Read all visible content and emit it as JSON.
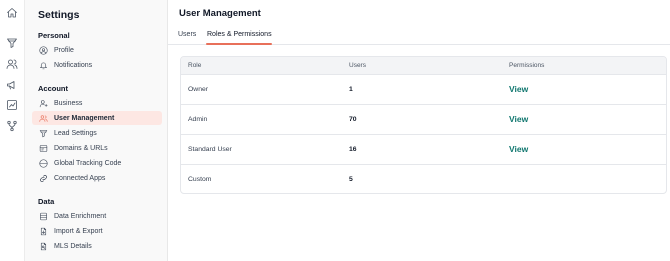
{
  "rail": {
    "icons": [
      "home-icon",
      "funnel-icon",
      "users-icon",
      "megaphone-icon",
      "chart-icon",
      "workflow-icon"
    ]
  },
  "sidebar": {
    "title": "Settings",
    "sections": [
      {
        "title": "Personal",
        "items": [
          {
            "label": "Profile",
            "icon": "user-circle-icon"
          },
          {
            "label": "Notifications",
            "icon": "bell-icon"
          }
        ]
      },
      {
        "title": "Account",
        "items": [
          {
            "label": "Business",
            "icon": "business-user-icon"
          },
          {
            "label": "User Management",
            "icon": "users-icon",
            "active": true
          },
          {
            "label": "Lead Settings",
            "icon": "funnel-icon"
          },
          {
            "label": "Domains & URLs",
            "icon": "domain-icon"
          },
          {
            "label": "Global Tracking Code",
            "icon": "globe-icon"
          },
          {
            "label": "Connected Apps",
            "icon": "link-icon"
          }
        ]
      },
      {
        "title": "Data",
        "items": [
          {
            "label": "Data Enrichment",
            "icon": "database-icon"
          },
          {
            "label": "Import & Export",
            "icon": "file-import-icon"
          },
          {
            "label": "MLS Details",
            "icon": "file-search-icon"
          }
        ]
      }
    ]
  },
  "main": {
    "title": "User Management",
    "tabs": [
      {
        "label": "Users",
        "active": false
      },
      {
        "label": "Roles & Permissions",
        "active": true
      }
    ],
    "table": {
      "columns": [
        "Role",
        "Users",
        "Permissions"
      ],
      "rows": [
        {
          "role": "Owner",
          "users": "1",
          "permissions": "View"
        },
        {
          "role": "Admin",
          "users": "70",
          "permissions": "View"
        },
        {
          "role": "Standard User",
          "users": "16",
          "permissions": "View"
        },
        {
          "role": "Custom",
          "users": "5",
          "permissions": ""
        }
      ]
    }
  },
  "colors": {
    "accent": "#e8705a",
    "active_bg": "#fde7e3",
    "link": "#0f766e"
  }
}
